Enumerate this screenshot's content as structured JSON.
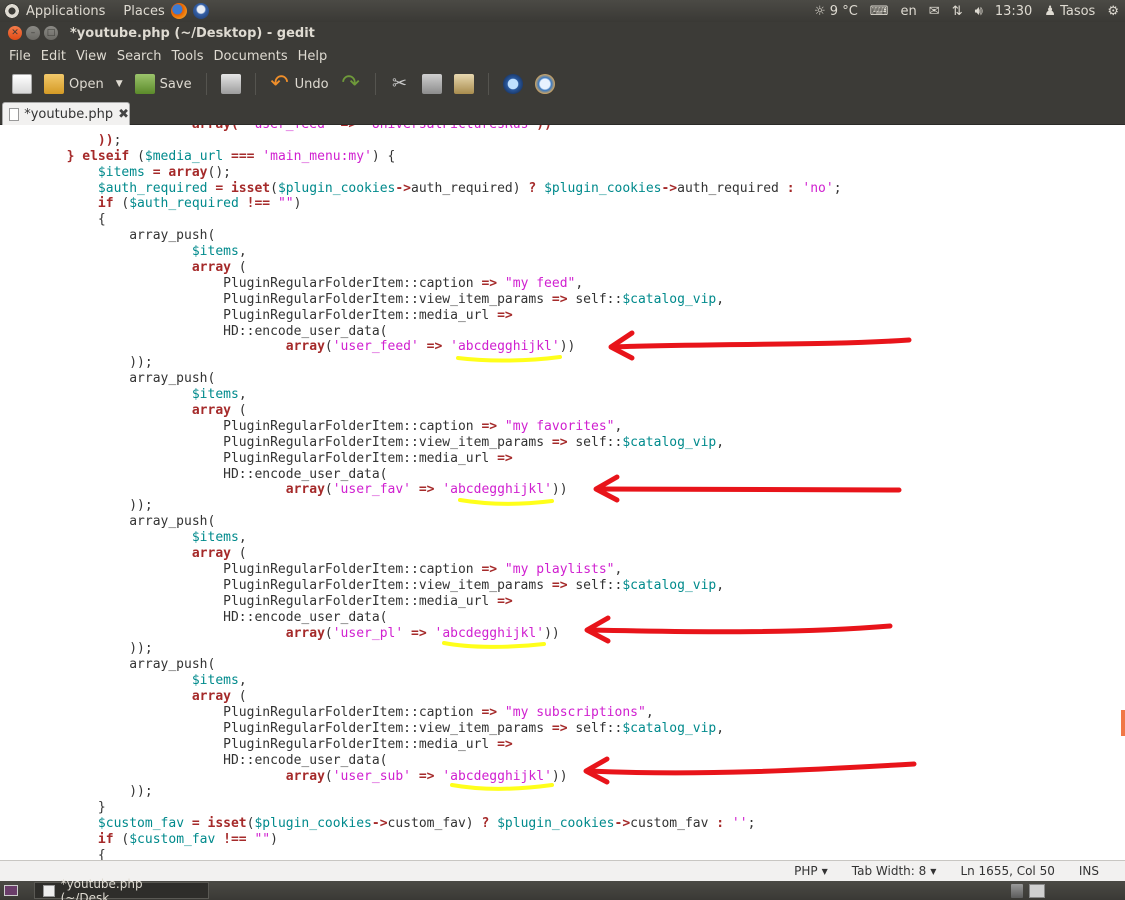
{
  "top_panel": {
    "applications": "Applications",
    "places": "Places",
    "weather": "9 °C",
    "keyboard_layout": "en",
    "clock": "13:30",
    "user": "Tasos"
  },
  "window": {
    "title": "*youtube.php (~/Desktop) - gedit"
  },
  "menu": [
    "File",
    "Edit",
    "View",
    "Search",
    "Tools",
    "Documents",
    "Help"
  ],
  "toolbar": {
    "open_label": "Open",
    "save_label": "Save",
    "undo_label": "Undo"
  },
  "tab": {
    "label": "*youtube.php"
  },
  "code_lines": [
    [
      [
        "                        ",
        ""
      ],
      [
        "array",
        "kw"
      ],
      [
        "( ",
        "op"
      ],
      [
        "'user_feed'",
        "str"
      ],
      [
        " => ",
        "op"
      ],
      [
        "'UniversalPicturesRus'",
        "str"
      ],
      [
        ")",
        "op"
      ],
      [
        ")",
        "op"
      ]
    ],
    [
      [
        "            ",
        ""
      ],
      [
        "))",
        "op"
      ],
      [
        ";",
        ""
      ]
    ],
    [
      [
        "        ",
        ""
      ],
      [
        "} ",
        "op"
      ],
      [
        "elseif",
        "kw"
      ],
      [
        " (",
        ""
      ],
      [
        "$media_url",
        "var"
      ],
      [
        " === ",
        "op"
      ],
      [
        "'main_menu:my'",
        "str"
      ],
      [
        ") {",
        ""
      ]
    ],
    [
      [
        "            ",
        ""
      ],
      [
        "$items",
        "var"
      ],
      [
        " = ",
        "op"
      ],
      [
        "array",
        "kw"
      ],
      [
        "();",
        ""
      ]
    ],
    [
      [
        "            ",
        ""
      ],
      [
        "$auth_required",
        "var"
      ],
      [
        " = ",
        "op"
      ],
      [
        "isset",
        "kw"
      ],
      [
        "(",
        ""
      ],
      [
        "$plugin_cookies",
        "var"
      ],
      [
        "->",
        "op"
      ],
      [
        "auth_required) ",
        ""
      ],
      [
        "? ",
        "op"
      ],
      [
        "$plugin_cookies",
        "var"
      ],
      [
        "->",
        "op"
      ],
      [
        "auth_required ",
        ""
      ],
      [
        ": ",
        "op"
      ],
      [
        "'no'",
        "str"
      ],
      [
        ";",
        ""
      ]
    ],
    [
      [
        "            ",
        ""
      ],
      [
        "if",
        "kw"
      ],
      [
        " (",
        ""
      ],
      [
        "$auth_required",
        "var"
      ],
      [
        " !== ",
        "op"
      ],
      [
        "\"\"",
        "str"
      ],
      [
        ")",
        ""
      ]
    ],
    [
      [
        "            {",
        ""
      ]
    ],
    [
      [
        "                array_push(",
        ""
      ]
    ],
    [
      [
        "                        ",
        ""
      ],
      [
        "$items",
        "var"
      ],
      [
        ",",
        ""
      ]
    ],
    [
      [
        "                        ",
        ""
      ],
      [
        "array",
        "kw"
      ],
      [
        " (",
        ""
      ]
    ],
    [
      [
        "                            PluginRegularFolderItem::caption ",
        ""
      ],
      [
        "=> ",
        "op"
      ],
      [
        "\"my feed\"",
        "str"
      ],
      [
        ",",
        ""
      ]
    ],
    [
      [
        "                            PluginRegularFolderItem::view_item_params ",
        ""
      ],
      [
        "=> ",
        "op"
      ],
      [
        "self::",
        ""
      ],
      [
        "$catalog_vip",
        "var"
      ],
      [
        ",",
        ""
      ]
    ],
    [
      [
        "                            PluginRegularFolderItem::media_url ",
        ""
      ],
      [
        "=>",
        "op"
      ]
    ],
    [
      [
        "                            HD::encode_user_data(",
        ""
      ]
    ],
    [
      [
        "                                    ",
        ""
      ],
      [
        "array",
        "kw"
      ],
      [
        "(",
        ""
      ],
      [
        "'user_feed'",
        "str"
      ],
      [
        " => ",
        "op"
      ],
      [
        "'abcdegghijkl'",
        "str"
      ],
      [
        "))",
        ""
      ]
    ],
    [
      [
        "                ));",
        ""
      ]
    ],
    [
      [
        "                array_push(",
        ""
      ]
    ],
    [
      [
        "                        ",
        ""
      ],
      [
        "$items",
        "var"
      ],
      [
        ",",
        ""
      ]
    ],
    [
      [
        "                        ",
        ""
      ],
      [
        "array",
        "kw"
      ],
      [
        " (",
        ""
      ]
    ],
    [
      [
        "                            PluginRegularFolderItem::caption ",
        ""
      ],
      [
        "=> ",
        "op"
      ],
      [
        "\"my favorites\"",
        "str"
      ],
      [
        ",",
        ""
      ]
    ],
    [
      [
        "                            PluginRegularFolderItem::view_item_params ",
        ""
      ],
      [
        "=> ",
        "op"
      ],
      [
        "self::",
        ""
      ],
      [
        "$catalog_vip",
        "var"
      ],
      [
        ",",
        ""
      ]
    ],
    [
      [
        "                            PluginRegularFolderItem::media_url ",
        ""
      ],
      [
        "=>",
        "op"
      ]
    ],
    [
      [
        "                            HD::encode_user_data(",
        ""
      ]
    ],
    [
      [
        "                                    ",
        ""
      ],
      [
        "array",
        "kw"
      ],
      [
        "(",
        ""
      ],
      [
        "'user_fav'",
        "str"
      ],
      [
        " => ",
        "op"
      ],
      [
        "'abcdegghijkl'",
        "str"
      ],
      [
        "))",
        ""
      ]
    ],
    [
      [
        "                ));",
        ""
      ]
    ],
    [
      [
        "                array_push(",
        ""
      ]
    ],
    [
      [
        "                        ",
        ""
      ],
      [
        "$items",
        "var"
      ],
      [
        ",",
        ""
      ]
    ],
    [
      [
        "                        ",
        ""
      ],
      [
        "array",
        "kw"
      ],
      [
        " (",
        ""
      ]
    ],
    [
      [
        "                            PluginRegularFolderItem::caption ",
        ""
      ],
      [
        "=> ",
        "op"
      ],
      [
        "\"my playlists\"",
        "str"
      ],
      [
        ",",
        ""
      ]
    ],
    [
      [
        "                            PluginRegularFolderItem::view_item_params ",
        ""
      ],
      [
        "=> ",
        "op"
      ],
      [
        "self::",
        ""
      ],
      [
        "$catalog_vip",
        "var"
      ],
      [
        ",",
        ""
      ]
    ],
    [
      [
        "                            PluginRegularFolderItem::media_url ",
        ""
      ],
      [
        "=>",
        "op"
      ]
    ],
    [
      [
        "                            HD::encode_user_data(",
        ""
      ]
    ],
    [
      [
        "                                    ",
        ""
      ],
      [
        "array",
        "kw"
      ],
      [
        "(",
        ""
      ],
      [
        "'user_pl'",
        "str"
      ],
      [
        " => ",
        "op"
      ],
      [
        "'abcdegghijkl'",
        "str"
      ],
      [
        "))",
        ""
      ]
    ],
    [
      [
        "                ));",
        ""
      ]
    ],
    [
      [
        "                array_push(",
        ""
      ]
    ],
    [
      [
        "                        ",
        ""
      ],
      [
        "$items",
        "var"
      ],
      [
        ",",
        ""
      ]
    ],
    [
      [
        "                        ",
        ""
      ],
      [
        "array",
        "kw"
      ],
      [
        " (",
        ""
      ]
    ],
    [
      [
        "                            PluginRegularFolderItem::caption ",
        ""
      ],
      [
        "=> ",
        "op"
      ],
      [
        "\"my subscriptions\"",
        "str"
      ],
      [
        ",",
        ""
      ]
    ],
    [
      [
        "                            PluginRegularFolderItem::view_item_params ",
        ""
      ],
      [
        "=> ",
        "op"
      ],
      [
        "self::",
        ""
      ],
      [
        "$catalog_vip",
        "var"
      ],
      [
        ",",
        ""
      ]
    ],
    [
      [
        "                            PluginRegularFolderItem::media_url ",
        ""
      ],
      [
        "=>",
        "op"
      ]
    ],
    [
      [
        "                            HD::encode_user_data(",
        ""
      ]
    ],
    [
      [
        "                                    ",
        ""
      ],
      [
        "array",
        "kw"
      ],
      [
        "(",
        ""
      ],
      [
        "'user_sub'",
        "str"
      ],
      [
        " => ",
        "op"
      ],
      [
        "'abcdegghijkl'",
        "str"
      ],
      [
        "))",
        ""
      ]
    ],
    [
      [
        "                ));",
        ""
      ]
    ],
    [
      [
        "            }",
        ""
      ]
    ],
    [
      [
        "            ",
        ""
      ],
      [
        "$custom_fav",
        "var"
      ],
      [
        " = ",
        "op"
      ],
      [
        "isset",
        "kw"
      ],
      [
        "(",
        ""
      ],
      [
        "$plugin_cookies",
        "var"
      ],
      [
        "->",
        "op"
      ],
      [
        "custom_fav) ",
        ""
      ],
      [
        "? ",
        "op"
      ],
      [
        "$plugin_cookies",
        "var"
      ],
      [
        "->",
        "op"
      ],
      [
        "custom_fav ",
        ""
      ],
      [
        ": ",
        "op"
      ],
      [
        "''",
        "str"
      ],
      [
        ";",
        ""
      ]
    ],
    [
      [
        "            ",
        ""
      ],
      [
        "if",
        "kw"
      ],
      [
        " (",
        ""
      ],
      [
        "$custom_fav",
        "var"
      ],
      [
        " !== ",
        "op"
      ],
      [
        "\"\"",
        "str"
      ],
      [
        ")",
        ""
      ]
    ],
    [
      [
        "            {",
        ""
      ]
    ]
  ],
  "status_bar": {
    "language": "PHP",
    "tab_width": "Tab Width: 8",
    "position": "Ln 1655, Col 50",
    "mode": "INS"
  },
  "taskbar": {
    "item_label": "*youtube.php (~/Desk..."
  },
  "annotation_colors": {
    "arrow": "#e8141a",
    "underline": "#ffff1a"
  }
}
